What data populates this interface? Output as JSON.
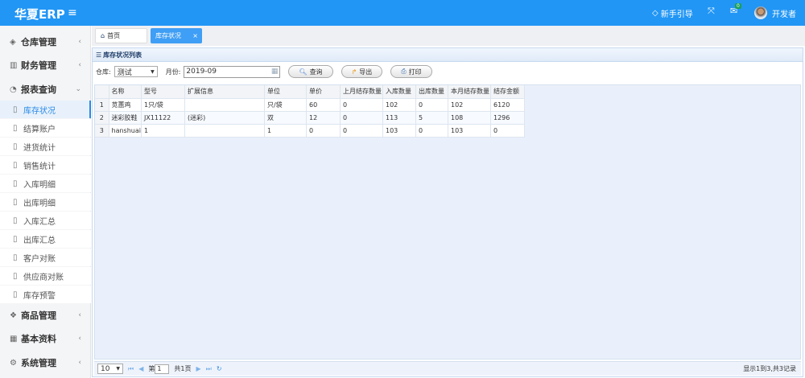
{
  "header": {
    "logo": "华夏ERP",
    "guide": "新手引导",
    "mail_badge": "0",
    "user": "开发者"
  },
  "sidebar": {
    "groups": [
      {
        "label": "仓库管理"
      },
      {
        "label": "财务管理"
      },
      {
        "label": "报表查询"
      },
      {
        "label": "商品管理"
      },
      {
        "label": "基本资料"
      },
      {
        "label": "系统管理"
      }
    ],
    "items": [
      {
        "label": "库存状况"
      },
      {
        "label": "结算账户"
      },
      {
        "label": "进货统计"
      },
      {
        "label": "销售统计"
      },
      {
        "label": "入库明细"
      },
      {
        "label": "出库明细"
      },
      {
        "label": "入库汇总"
      },
      {
        "label": "出库汇总"
      },
      {
        "label": "客户对账"
      },
      {
        "label": "供应商对账"
      },
      {
        "label": "库存预警"
      }
    ]
  },
  "tabs": {
    "home": "首页",
    "active": "库存状况",
    "close": "×"
  },
  "panel": {
    "title": "库存状况列表"
  },
  "toolbar": {
    "warehouse_label": "仓库:",
    "warehouse_value": "测试",
    "month_label": "月份:",
    "month_value": "2019-09",
    "query": "查询",
    "export": "导出",
    "print": "打印"
  },
  "table": {
    "columns": [
      "名称",
      "型号",
      "扩展信息",
      "单位",
      "单价",
      "上月结存数量",
      "入库数量",
      "出库数量",
      "本月结存数量",
      "结存金额"
    ],
    "rows": [
      [
        "1",
        "苋蕙鸡",
        "1只/袋",
        "",
        "只/袋",
        "60",
        "0",
        "102",
        "0",
        "102",
        "6120"
      ],
      [
        "2",
        "迷彩胶鞋",
        "JX11122",
        "(迷彩)",
        "双",
        "12",
        "0",
        "113",
        "5",
        "108",
        "1296"
      ],
      [
        "3",
        "hanshuai",
        "1",
        "",
        "1",
        "0",
        "0",
        "103",
        "0",
        "103",
        "0"
      ]
    ]
  },
  "pager": {
    "page_size": "10",
    "page_prefix": "第",
    "page": "1",
    "page_suffix": "共1页",
    "summary": "显示1到3,共3记录"
  }
}
